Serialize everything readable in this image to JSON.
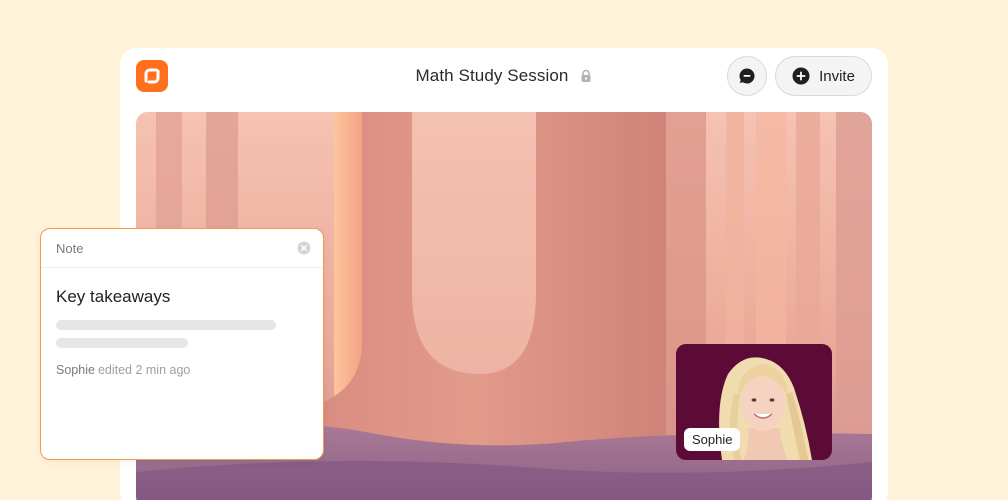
{
  "header": {
    "title": "Math Study Session",
    "invite_label": "Invite",
    "icons": {
      "logo": "app-logo-icon",
      "lock": "lock-icon",
      "chat": "chat-bubble-icon",
      "plus": "plus-circle-icon"
    }
  },
  "note": {
    "label": "Note",
    "title": "Key takeaways",
    "author": "Sophie",
    "edited": "edited 2 min ago"
  },
  "participant": {
    "name": "Sophie"
  },
  "colors": {
    "background": "#fff2d9",
    "brand": "#ff6f1c",
    "note_border": "#f29a4a",
    "participant_tile": "#5b0b35"
  }
}
